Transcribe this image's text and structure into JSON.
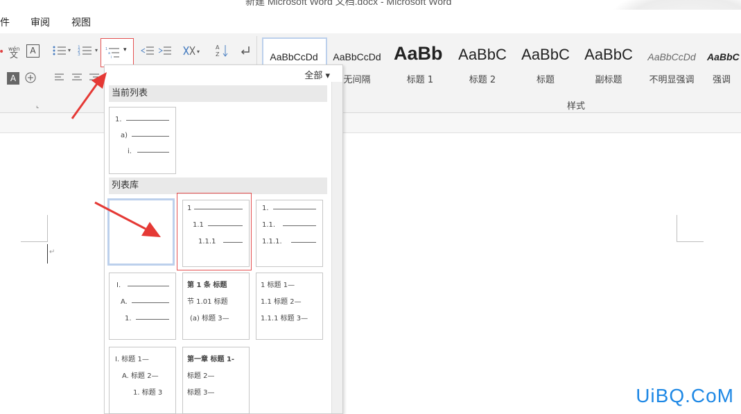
{
  "window": {
    "title": "新建 Microsoft Word 文档.docx - Microsoft Word"
  },
  "tabs": [
    {
      "label": "件"
    },
    {
      "label": "审阅"
    },
    {
      "label": "视图"
    }
  ],
  "styles": {
    "group_label": "样式",
    "items": [
      {
        "sample": "AaBbCcDd",
        "label": ""
      },
      {
        "sample": "AaBbCcDd",
        "label": "无间隔"
      },
      {
        "sample": "AaBb",
        "label": "标题 1"
      },
      {
        "sample": "AaBbC",
        "label": "标题 2"
      },
      {
        "sample": "AaBbC",
        "label": "标题"
      },
      {
        "sample": "AaBbC",
        "label": "副标题"
      },
      {
        "sample": "AaBbCcDd",
        "label": "不明显强调"
      },
      {
        "sample": "AaBbC",
        "label": "强调"
      }
    ]
  },
  "ribbon": {
    "font_box": "A",
    "phonetic": "文",
    "phonetic_top": "wén",
    "highlight": "A",
    "sort": "A↓Z"
  },
  "list_panel": {
    "filter_label": "全部",
    "current_section": "当前列表",
    "library_section": "列表库",
    "current_list": [
      "1.",
      "a)",
      "i."
    ],
    "library": [
      {
        "lines": []
      },
      {
        "lines": [
          "1",
          "1.1",
          "1.1.1"
        ]
      },
      {
        "lines": [
          "1.",
          "1.1.",
          "1.1.1."
        ]
      },
      {
        "lines": [
          "I.",
          "A.",
          "1."
        ]
      },
      {
        "lines": [
          "第 1 条 标题",
          "节 1.01 标题",
          "(a) 标题 3—"
        ]
      },
      {
        "lines": [
          "1 标题 1—",
          "1.1 标题 2—",
          "1.1.1 标题 3—"
        ]
      },
      {
        "lines": [
          "I. 标题 1—",
          "A. 标题 2—",
          "1. 标题 3"
        ]
      },
      {
        "lines": [
          "第一章 标题 1-",
          "标题 2—",
          "标题 3—"
        ]
      }
    ]
  },
  "watermark": "UiBQ.CoM",
  "colors": {
    "annotation_red": "#e53935",
    "watermark_blue": "#1e88e5"
  }
}
